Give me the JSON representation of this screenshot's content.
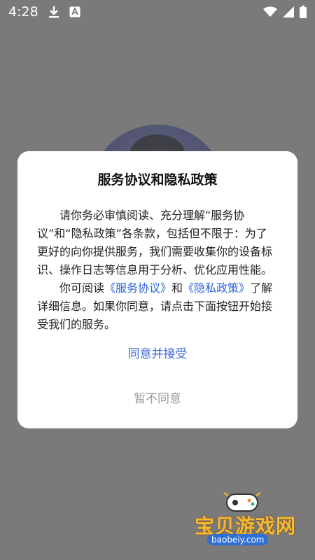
{
  "status_bar": {
    "time": "4:28"
  },
  "dialog": {
    "title": "服务协议和隐私政策",
    "para1": "请你务必审慎阅读、充分理解“服务协议”和“隐私政策”各条款，包括但不限于：为了更好的向你提供服务，我们需要收集你的设备标识、操作日志等信息用于分析、优化应用性能。",
    "para2_prefix": "你可阅读",
    "link_service": "《服务协议》",
    "para2_and": "和",
    "link_privacy": "《隐私政策》",
    "para2_suffix": "了解详细信息。如果你同意，请点击下面按钮开始接受我们的服务。",
    "agree_label": "同意并接受",
    "disagree_label": "暂不同意"
  },
  "watermark": {
    "brand": "宝贝游戏网",
    "domain": "baobeiy.com"
  },
  "colors": {
    "link": "#2f62d8",
    "agree": "#3a66d6",
    "disagree": "#9a9a9a",
    "overlay": "#7a7a7a"
  }
}
